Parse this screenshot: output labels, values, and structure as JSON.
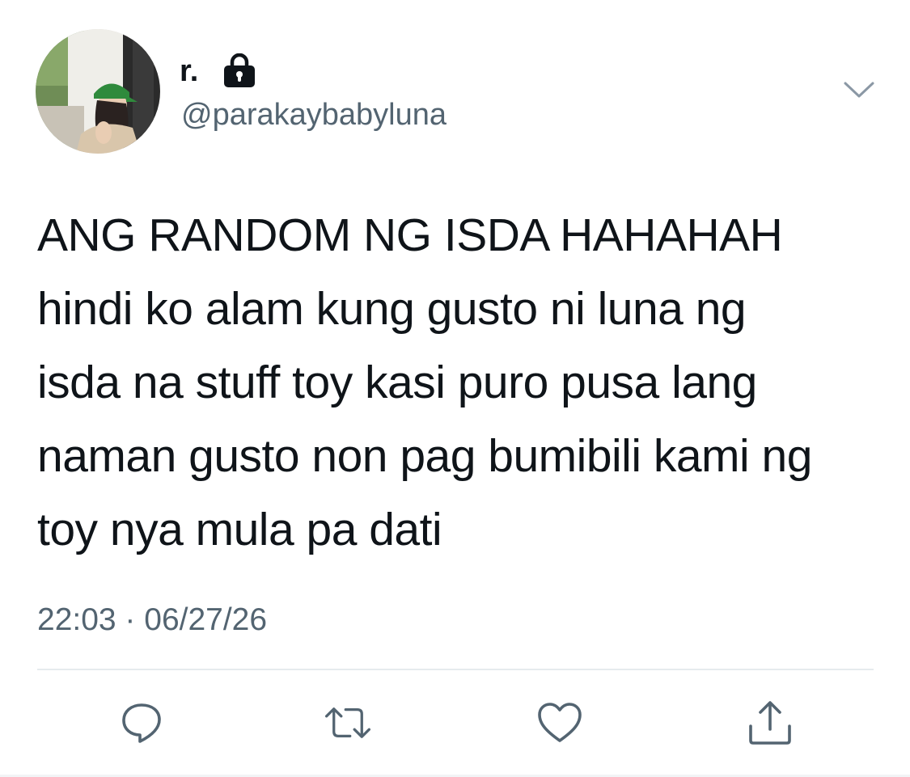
{
  "user": {
    "display_name": "r.",
    "handle": "@parakaybabyluna",
    "protected_icon": "lock-icon",
    "avatar_icon": "profile-photo"
  },
  "tweet": {
    "lines": [
      "ANG RANDOM NG ISDA HAHAHAH",
      "hindi ko alam kung gusto ni luna ng",
      "isda na stuff toy kasi puro pusa lang",
      "naman gusto non pag bumibili kami ng",
      "toy nya mula pa dati"
    ],
    "timestamp": "22:03 · 06/27/26"
  },
  "actions": [
    {
      "name": "reply",
      "icon": "reply-icon"
    },
    {
      "name": "retweet",
      "icon": "retweet-icon"
    },
    {
      "name": "like",
      "icon": "heart-icon"
    },
    {
      "name": "share",
      "icon": "share-icon"
    }
  ],
  "colors": {
    "text": "#0f1419",
    "secondary": "#536471",
    "divider": "#e6ebee",
    "icon": "#536471"
  }
}
